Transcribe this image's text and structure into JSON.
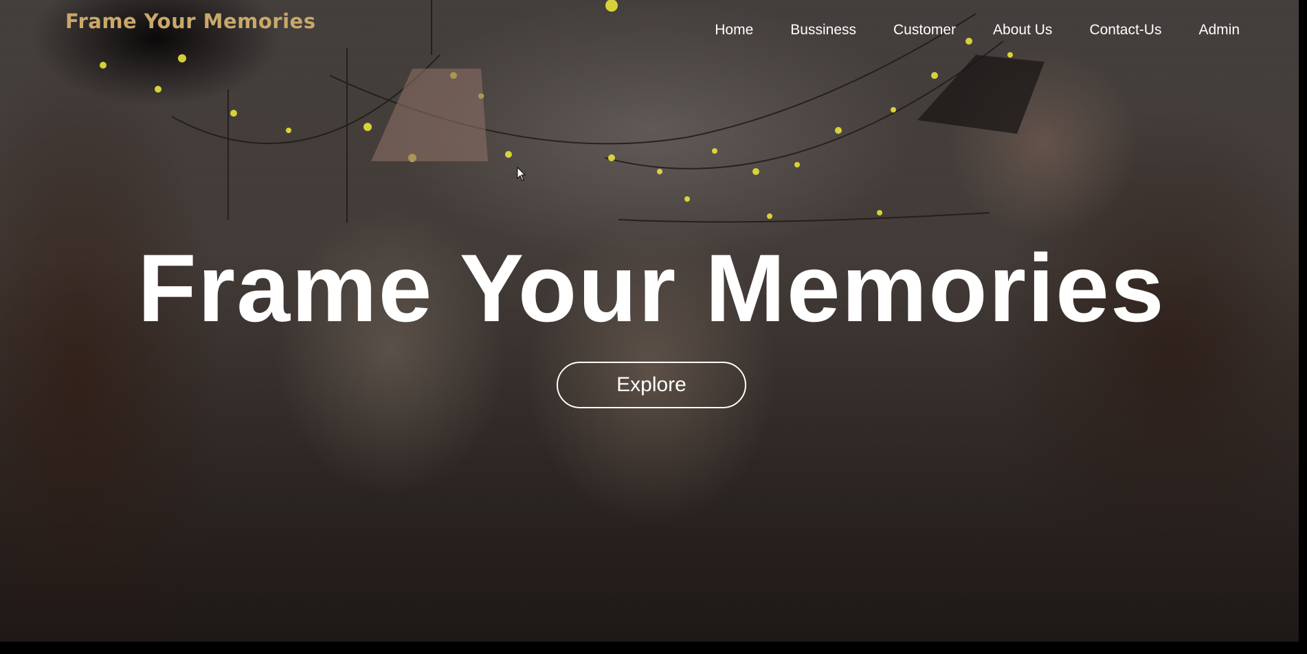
{
  "brand": {
    "logo_text": "Frame Your Memories",
    "logo_color": "#c9a86a"
  },
  "nav": {
    "items": [
      {
        "label": "Home"
      },
      {
        "label": "Bussiness"
      },
      {
        "label": "Customer"
      },
      {
        "label": "About Us"
      },
      {
        "label": "Contact-Us"
      },
      {
        "label": "Admin"
      }
    ]
  },
  "hero": {
    "title": "Frame Your Memories",
    "cta_label": "Explore",
    "background_description_icon": "party-video-background"
  },
  "icons": {
    "cursor": "mouse-pointer-icon"
  }
}
